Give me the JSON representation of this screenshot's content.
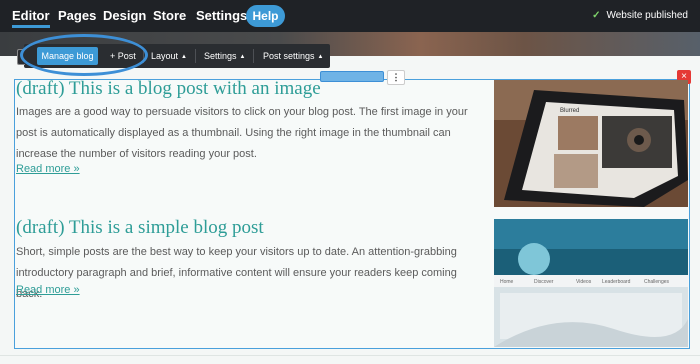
{
  "nav": {
    "items": [
      {
        "label": "Editor",
        "active": true
      },
      {
        "label": "Pages"
      },
      {
        "label": "Design"
      },
      {
        "label": "Store"
      },
      {
        "label": "Settings"
      }
    ],
    "help_label": "Help",
    "status": "Website published",
    "status_icon": "check-icon"
  },
  "blog_toolbar": {
    "manage": "Manage blog",
    "add_post": "+ Post",
    "layout": "Layout",
    "settings": "Settings",
    "post_settings": "Post settings"
  },
  "widget": {
    "more_icon": "more-vertical-icon",
    "delete_icon": "close-icon"
  },
  "posts": [
    {
      "title": "(draft) This is a blog post with an image",
      "body": "Images are a good way to persuade visitors to click on your blog post. The first image in your post is automatically displayed as a thumbnail. Using the right image in the thumbnail can increase the number of visitors reading your post.",
      "read_more": "Read more »",
      "thumb_label": "Blurred"
    },
    {
      "title": "(draft) This is a simple blog post",
      "body": "Short, simple posts are the best way to keep your visitors up to date. An attention-grabbing introductory paragraph and brief, informative content will ensure your readers keep coming back.",
      "read_more": "Read more »",
      "thumb_tabs": [
        "Home",
        "Discover",
        "Videos",
        "Leaderboard",
        "Challenges"
      ]
    }
  ]
}
